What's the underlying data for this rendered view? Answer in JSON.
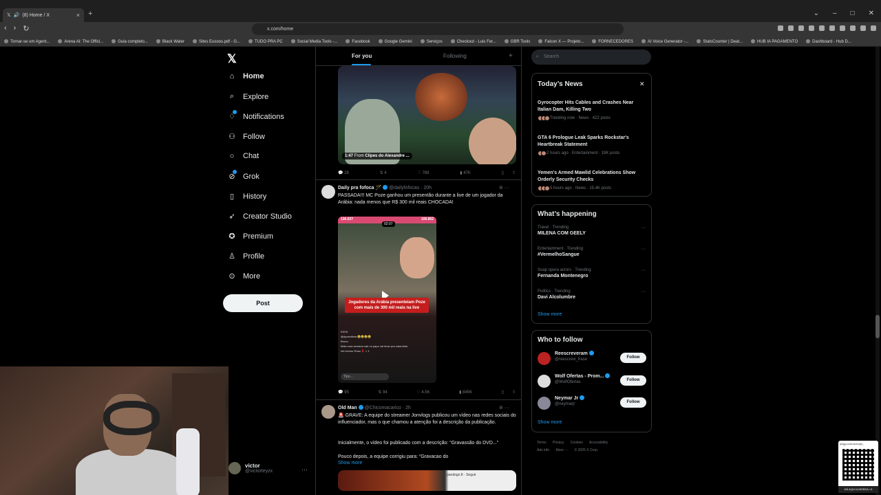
{
  "browser": {
    "tab_title": "(8) Home / X",
    "url": "x.com/home",
    "bookmarks": [
      "Tornar-se um Agent...",
      "Arena AI: The Offici...",
      "Guia completo...",
      "Black Water",
      "Sites Eusoos.pdf - G...",
      "TUDO PRA PC",
      "Social Media Tools -...",
      "Facebook",
      "Google Gemini",
      "Serviços",
      "Checkout - Luis Fer...",
      "GBR Tools",
      "Falcon X — Projeto...",
      "FORNECEDORES",
      "AI Voice Generator -...",
      "StatsCounter | Deat...",
      "HUB IA PAGAMENTO",
      "Dashboard - Hub D..."
    ]
  },
  "sidebar": {
    "items": [
      {
        "label": "Home",
        "icon": "home-icon"
      },
      {
        "label": "Explore",
        "icon": "search-icon"
      },
      {
        "label": "Notifications",
        "icon": "bell-icon"
      },
      {
        "label": "Follow",
        "icon": "person-add-icon"
      },
      {
        "label": "Chat",
        "icon": "chat-icon"
      },
      {
        "label": "Grok",
        "icon": "grok-icon"
      },
      {
        "label": "History",
        "icon": "bookmark-icon"
      },
      {
        "label": "Creator Studio",
        "icon": "rocket-icon"
      },
      {
        "label": "Premium",
        "icon": "verified-icon"
      },
      {
        "label": "Profile",
        "icon": "person-icon"
      },
      {
        "label": "More",
        "icon": "more-circle-icon"
      }
    ],
    "post_label": "Post",
    "account": {
      "name": "victor",
      "handle": "@victorteyzx"
    }
  },
  "feed": {
    "tabs": [
      "For you",
      "Following"
    ],
    "tweet1": {
      "duration": "1:47",
      "from_label": "From",
      "from_name": "Clipes do Alexandre ...",
      "replies": "28",
      "reposts": "4",
      "likes": "789",
      "views": "47K"
    },
    "tweet2": {
      "name": "Daily pra fofoca 🪄",
      "handle": "@dailyfofocas · 20h",
      "text": "PASSADA!!! MC Poze ganhou um presentão durante a live de um jogador da Arábia: nada menos que R$ 300 mil reais CHOCADA!",
      "video_left_count": "136.627",
      "video_right_count": "106.862",
      "video_timer": "02:07",
      "video_caption": "Jogadores da Arábia presenteiam Poze com mais de 300 mil reais na live",
      "chat_lines": [
        "KKKK",
        "@dyoestilma 😂😂😂😂",
        "Bruno",
        "Mais uma semana cair no papo vai levar pra casa kkkk",
        "ebl enviou Rosa 🌹 × 1"
      ],
      "input_placeholder": "Tipo...",
      "replies": "95",
      "reposts": "94",
      "likes": "4.5K",
      "views": "845K"
    },
    "tweet3": {
      "name": "Old Man",
      "handle": "@Chicomacarico · 2h",
      "p1": "🚨 GRAVE: A equipe do streamer Jonvlogs publicou um vídeo nas redes sociais do influenciador, mas o que chamou a atenção foi a descrição da publicação.",
      "p2": "Inicialmente, o vídeo foi publicado com a descrição: “Gravassão do DVD...”",
      "p3": "Pouco depois, a equipe corrigiu para: “Gravacao do",
      "show_more": "Show more",
      "media_label": "paodogo.ft · Seguir"
    }
  },
  "right": {
    "search_placeholder": "Search",
    "news_title": "Today’s News",
    "news": [
      {
        "title": "Gyrocopter Hits Cables and Crashes Near Italian Dam, Killing Two",
        "meta": "Trending now · News · 422 posts"
      },
      {
        "title": "GTA 6 Prologue Leak Sparks Rockstar's Heartbreak Statement",
        "meta": "2 hours ago · Entertainment · 19K posts"
      },
      {
        "title": "Yemen's Armed Mawlid Celebrations Show Orderly Security Checks",
        "meta": "5 hours ago · News · 15.4K posts"
      }
    ],
    "happening_title": "What’s happening",
    "trends": [
      {
        "context": "Travel · Trending",
        "name": "MILENA COM GEELY"
      },
      {
        "context": "Entertainment · Trending",
        "name": "#VermelhoSangue"
      },
      {
        "context": "Soap opera actors · Trending",
        "name": "Fernanda Montenegro"
      },
      {
        "context": "Politics · Trending",
        "name": "Davi Alcolumbre"
      }
    ],
    "show_more": "Show more",
    "who_title": "Who to follow",
    "who": [
      {
        "name": "Reescreveram",
        "handle": "@reescrevi_frase",
        "btn": "Follow"
      },
      {
        "name": "Wolf Ofertas - Prom...",
        "handle": "@WolfOfertas",
        "btn": "Follow"
      },
      {
        "name": "Neymar Jr",
        "handle": "@neymarjr",
        "btn": "Follow"
      }
    ],
    "who_show_more": "Show more",
    "footer": [
      "Terms",
      "Privacy",
      "Cookies",
      "Accessibility",
      "Ads info",
      "More ···",
      "© 2025 X Corp."
    ]
  },
  "overlay": {
    "qr_url": "pixgg.com/victorpe_",
    "qr_caption": "DÁ AQUI A MOEDA <3"
  }
}
